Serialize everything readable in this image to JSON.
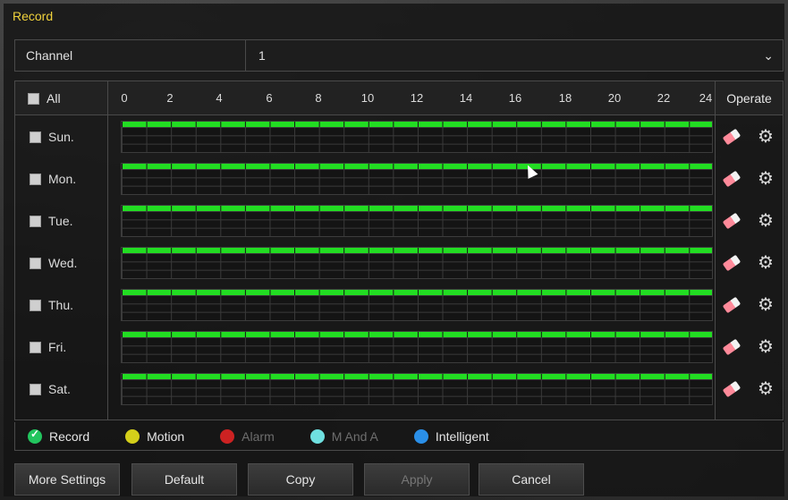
{
  "window": {
    "title": "Record"
  },
  "channel": {
    "label": "Channel",
    "value": "1"
  },
  "schedule": {
    "all_label": "All",
    "operate_label": "Operate",
    "ticks": [
      "0",
      "2",
      "4",
      "6",
      "8",
      "10",
      "12",
      "14",
      "16",
      "18",
      "20",
      "22",
      "24"
    ],
    "days": [
      {
        "label": "Sun.",
        "record_fraction": 1.0
      },
      {
        "label": "Mon.",
        "record_fraction": 1.0
      },
      {
        "label": "Tue.",
        "record_fraction": 1.0
      },
      {
        "label": "Wed.",
        "record_fraction": 1.0
      },
      {
        "label": "Thu.",
        "record_fraction": 1.0
      },
      {
        "label": "Fri.",
        "record_fraction": 1.0
      },
      {
        "label": "Sat.",
        "record_fraction": 1.0
      }
    ],
    "record_color": "#22dd22",
    "icons": {
      "edit": "eraser-icon",
      "settings": "gear-icon"
    }
  },
  "legend": [
    {
      "label": "Record",
      "color": "#22c55e",
      "enabled": true,
      "checked": true
    },
    {
      "label": "Motion",
      "color": "#d4cf1a",
      "enabled": true,
      "checked": false
    },
    {
      "label": "Alarm",
      "color": "#cc2222",
      "enabled": false,
      "checked": false
    },
    {
      "label": "M And A",
      "color": "#6fe0e0",
      "enabled": false,
      "checked": false
    },
    {
      "label": "Intelligent",
      "color": "#2a8fe8",
      "enabled": true,
      "checked": false
    }
  ],
  "buttons": {
    "more_settings": "More Settings",
    "default": "Default",
    "copy": "Copy",
    "apply": "Apply",
    "cancel": "Cancel"
  }
}
